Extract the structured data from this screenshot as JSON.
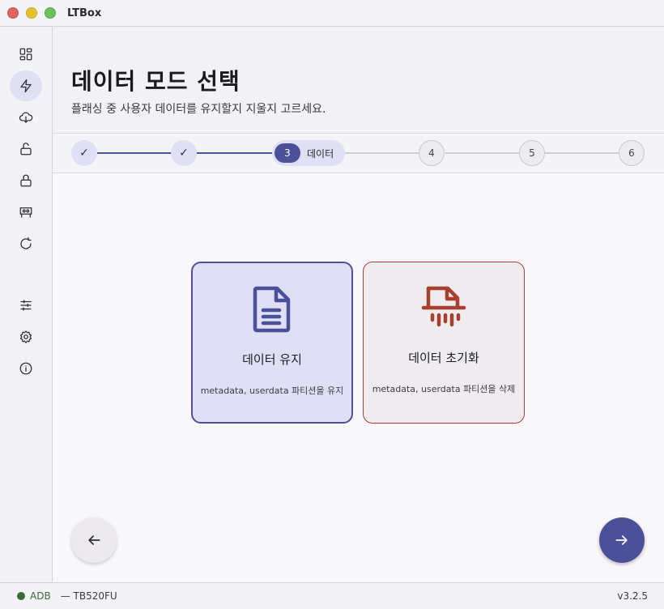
{
  "window": {
    "title": "LTBox"
  },
  "sidebar": {
    "items": [
      {
        "icon": "dashboard-icon"
      },
      {
        "icon": "flash-icon",
        "active": true
      },
      {
        "icon": "cloud-download-icon"
      },
      {
        "icon": "unlock-icon"
      },
      {
        "icon": "lock-icon"
      },
      {
        "icon": "device-board-icon"
      },
      {
        "icon": "refresh-icon"
      },
      {
        "icon": "sliders-icon"
      },
      {
        "icon": "gear-icon"
      },
      {
        "icon": "info-icon"
      }
    ]
  },
  "header": {
    "title": "데이터 모드 선택",
    "subtitle": "플래싱 중 사용자 데이터를 유지할지 지울지 고르세요."
  },
  "stepper": {
    "steps": [
      {
        "label": "✓",
        "state": "done"
      },
      {
        "label": "✓",
        "state": "done"
      },
      {
        "label": "3",
        "title": "데이터",
        "state": "active"
      },
      {
        "label": "4",
        "state": "todo"
      },
      {
        "label": "5",
        "state": "todo"
      },
      {
        "label": "6",
        "state": "todo"
      }
    ]
  },
  "options": {
    "keep": {
      "icon": "document-icon",
      "title": "데이터 유지",
      "desc": "metadata, userdata 파티션을 유지",
      "selected": true
    },
    "wipe": {
      "icon": "shredder-icon",
      "title": "데이터 초기화",
      "desc": "metadata, userdata 파티션을 삭제",
      "selected": false
    }
  },
  "colors": {
    "primary": "#4b5098",
    "danger": "#a8402e",
    "status_ok": "#3d6b37"
  },
  "statusbar": {
    "connection": "ADB",
    "device": "— TB520FU",
    "version": "v3.2.5"
  }
}
